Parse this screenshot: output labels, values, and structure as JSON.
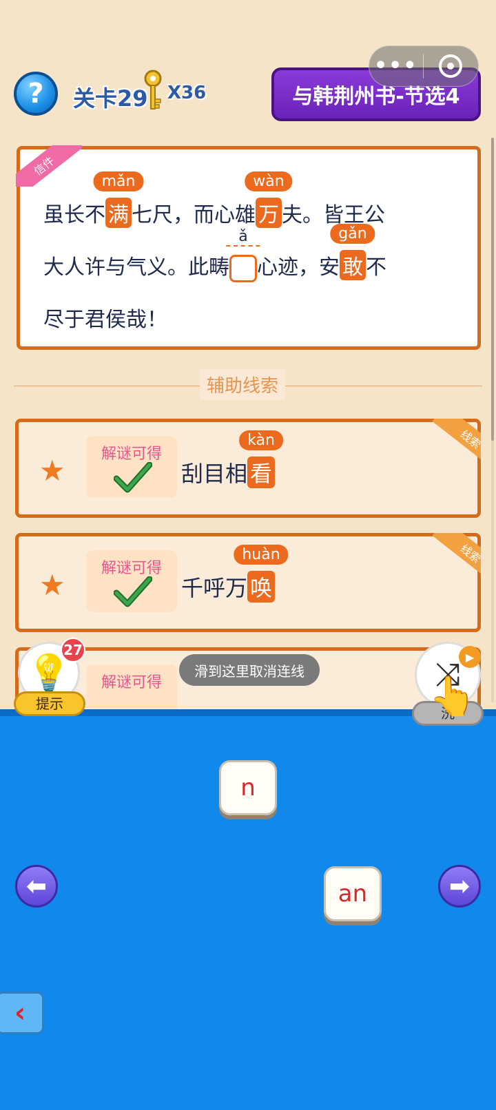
{
  "header": {
    "level_label": "关卡29",
    "key_count": "X36",
    "title": "与韩荆州书-节选4",
    "capsule_more": "•••"
  },
  "letter": {
    "tag": "信件",
    "line1": {
      "t1": "虽长不",
      "c1": "满",
      "p1": "mǎn",
      "t2": "七尺，而心雄",
      "c2": "万",
      "p2": "wàn",
      "t3": "夫。皆王公"
    },
    "line2": {
      "t1": "大人许与气义。此畴",
      "blank_pinyin": "ǎ",
      "t2": "心迹，安",
      "c3": "敢",
      "p3": "gǎn",
      "t3": "不"
    },
    "line3": "尽于君侯哉！"
  },
  "aux_label": "辅助线索",
  "clues": [
    {
      "corner": "线索",
      "badge": "解谜可得",
      "text": "刮目相",
      "char": "看",
      "pinyin": "kàn"
    },
    {
      "corner": "线索",
      "badge": "解谜可得",
      "text": "千呼万",
      "char": "唤",
      "pinyin": "huàn"
    },
    {
      "corner": "线索",
      "badge": "解谜可得",
      "text": "",
      "char": "",
      "pinyin": ""
    }
  ],
  "controls": {
    "hint_label": "提示",
    "hint_count": "27",
    "cancel_text": "滑到这里取消连线",
    "shuffle_label": "洗"
  },
  "tiles": {
    "tile1": "n",
    "tile2": "an"
  },
  "colors": {
    "accent": "#ec6a1e",
    "board": "#1189ec",
    "banner": "#6a22b8"
  }
}
